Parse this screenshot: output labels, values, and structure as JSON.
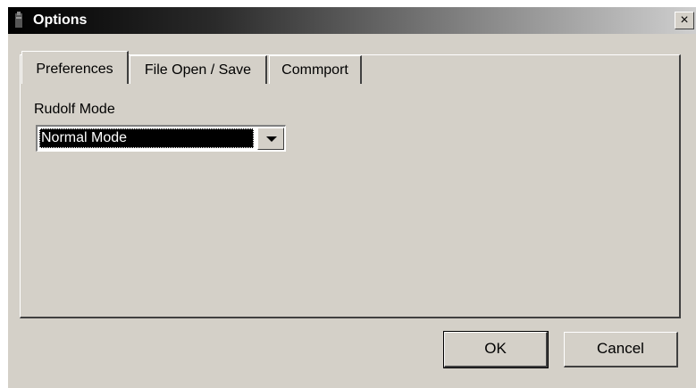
{
  "window": {
    "title": "Options",
    "close_label": "×"
  },
  "tabs": [
    {
      "label": "Preferences",
      "active": true
    },
    {
      "label": "File Open / Save",
      "active": false
    },
    {
      "label": "Commport",
      "active": false
    }
  ],
  "preferences": {
    "mode_label": "Rudolf Mode",
    "mode_value": "Normal Mode"
  },
  "buttons": {
    "ok_label": "OK",
    "cancel_label": "Cancel"
  },
  "icons": {
    "app": "options-app-icon",
    "dropdown": "chevron-down-icon"
  }
}
